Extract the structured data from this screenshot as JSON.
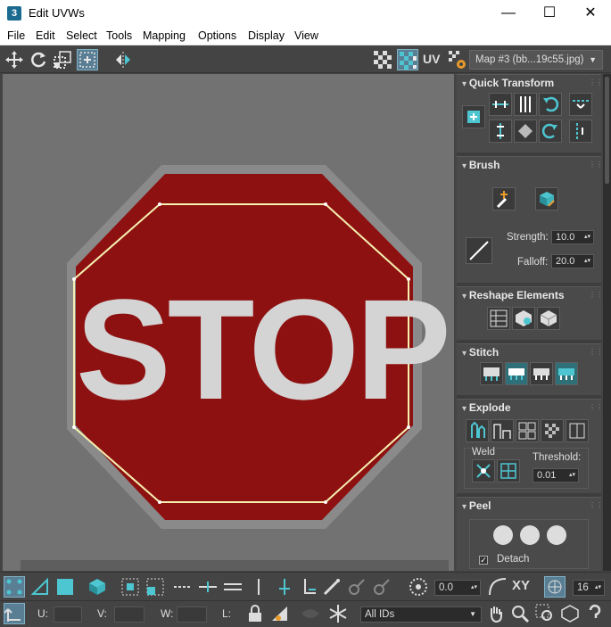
{
  "window": {
    "title": "Edit UVWs",
    "app_icon": "3"
  },
  "menu": [
    "File",
    "Edit",
    "Select",
    "Tools",
    "Mapping",
    "Options",
    "Display",
    "View"
  ],
  "toolbar": {
    "uv_label": "UV",
    "map_select": "Map #3 (bb...19c55.jpg)"
  },
  "viewport": {
    "texture_text": "STOP"
  },
  "panel": {
    "quick_transform": {
      "title": "Quick Transform"
    },
    "brush": {
      "title": "Brush",
      "strength_label": "Strength:",
      "strength_value": "10.0",
      "falloff_label": "Falloff:",
      "falloff_value": "20.0"
    },
    "reshape": {
      "title": "Reshape Elements"
    },
    "stitch": {
      "title": "Stitch"
    },
    "explode": {
      "title": "Explode",
      "weld_label": "Weld",
      "threshold_label": "Threshold:",
      "threshold_value": "0.01"
    },
    "peel": {
      "title": "Peel",
      "detach_label": "Detach"
    }
  },
  "bottom": {
    "rotate_value": "0.0",
    "xy_label": "XY",
    "grid_value": "16",
    "u_label": "U:",
    "v_label": "V:",
    "w_label": "W:",
    "l_label": "L:",
    "ids_select": "All IDs"
  },
  "colors": {
    "accent": "#4dc6d1",
    "panel_bg": "#4a4a4a",
    "sign_red": "#9a1010"
  }
}
